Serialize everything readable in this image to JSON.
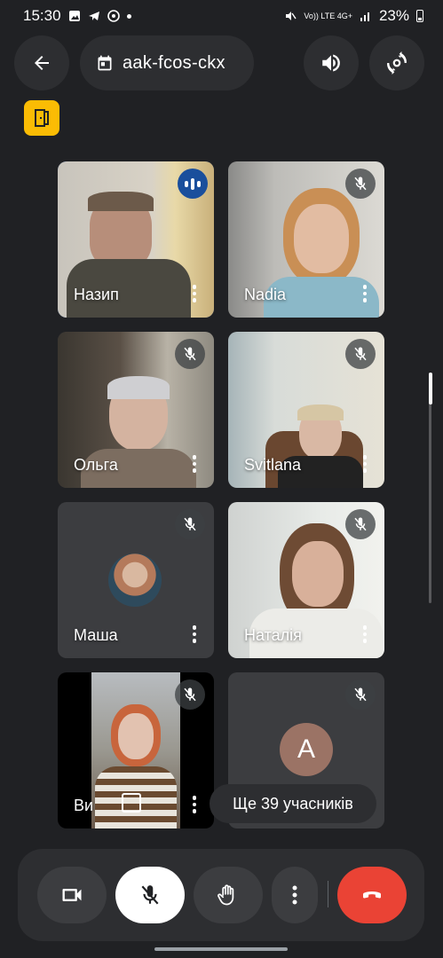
{
  "status_bar": {
    "time": "15:30",
    "network": "Vo)) LTE 4G+",
    "battery": "23%"
  },
  "top_bar": {
    "meeting_code": "aak-fcos-ckx"
  },
  "tiles": [
    {
      "name": "Назип",
      "speaking": true,
      "muted": false,
      "active": true
    },
    {
      "name": "Nadia",
      "speaking": false,
      "muted": true
    },
    {
      "name": "Ольга",
      "speaking": false,
      "muted": true
    },
    {
      "name": "Svitlana",
      "speaking": false,
      "muted": true
    },
    {
      "name": "Маша",
      "speaking": false,
      "muted": true,
      "avatar": true
    },
    {
      "name": "Наталія",
      "speaking": false,
      "muted": true
    },
    {
      "name": "Ви",
      "speaking": false,
      "muted": true
    },
    {
      "name": "",
      "speaking": false,
      "muted": true,
      "avatar_letter": "A"
    }
  ],
  "more_participants": "Ще 39 учасників",
  "colors": {
    "background": "#202124",
    "surface": "#2d2e31",
    "accent_yellow": "#fbbc04",
    "end_call_red": "#ea4335",
    "speaking_blue": "#1a4f9c"
  }
}
